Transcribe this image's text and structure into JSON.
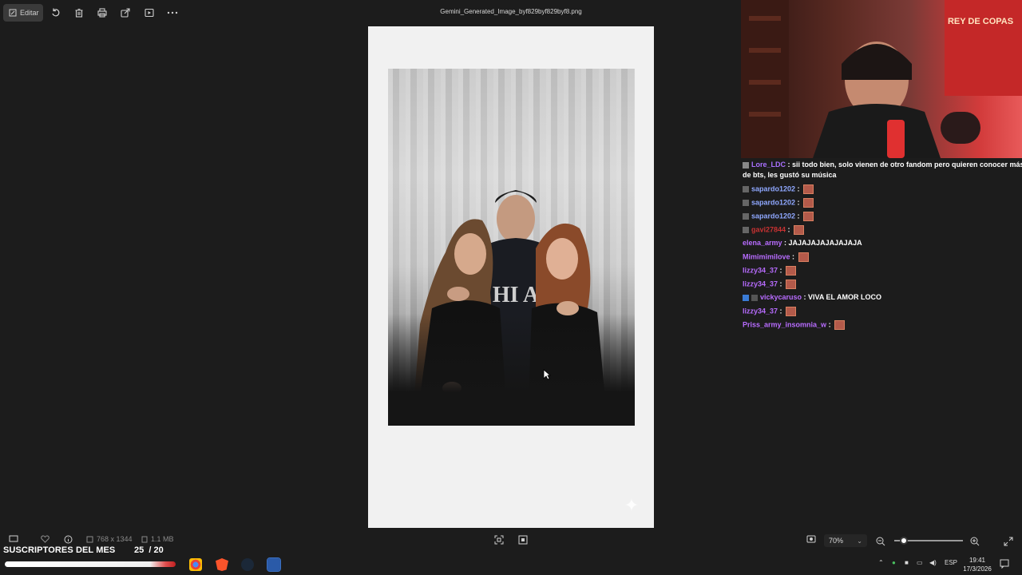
{
  "toolbar": {
    "edit_label": "Editar",
    "filename": "Gemini_Generated_Image_byf829byf829byf8.png",
    "icons": [
      "rotate-icon",
      "delete-icon",
      "print-icon",
      "share-icon",
      "slideshow-icon",
      "more-icon"
    ]
  },
  "chat": {
    "messages": [
      {
        "user": "Lore_LDC",
        "user_color": "#a970ff",
        "text": "sii todo bien, solo vienen de otro fandom pero quieren conocer más",
        "text2": "de bts, les gustó su música",
        "emote": false
      },
      {
        "user": "sapardo1202",
        "user_color": "#8fa8ff",
        "text": "",
        "emote": true
      },
      {
        "user": "sapardo1202",
        "user_color": "#8fa8ff",
        "text": "",
        "emote": true
      },
      {
        "user": "sapardo1202",
        "user_color": "#8fa8ff",
        "text": "",
        "emote": true
      },
      {
        "user": "gavi27844",
        "user_color": "#c83232",
        "text": "",
        "emote": true
      },
      {
        "user": "elena_army",
        "user_color": "#b86cff",
        "text": "JAJAJAJAJAJAJAJA",
        "emote": false
      },
      {
        "user": "Mimimimilove",
        "user_color": "#b86cff",
        "text": "",
        "emote": true
      },
      {
        "user": "lizzy34_37",
        "user_color": "#b86cff",
        "text": "",
        "emote": true
      },
      {
        "user": "lizzy34_37",
        "user_color": "#b86cff",
        "text": "",
        "emote": true
      },
      {
        "user": "vickycaruso",
        "user_color": "#b86cff",
        "text": "VIVA EL AMOR LOCO",
        "emote": false
      },
      {
        "user": "lizzy34_37",
        "user_color": "#b86cff",
        "text": "",
        "emote": true
      },
      {
        "user": "Priss_army_insomnia_w",
        "user_color": "#b86cff",
        "text": "",
        "emote": true
      }
    ]
  },
  "infobar": {
    "dimensions": "768 x 1344",
    "filesize": "1.1 MB",
    "zoom": "70%"
  },
  "overlay": {
    "subs_label": "SUSCRIPTORES DEL MES",
    "subs_count": "25",
    "subs_goal": "/ 20"
  },
  "taskbar": {
    "lang": "ESP",
    "time": "19:41",
    "date": "17/3/2026"
  }
}
